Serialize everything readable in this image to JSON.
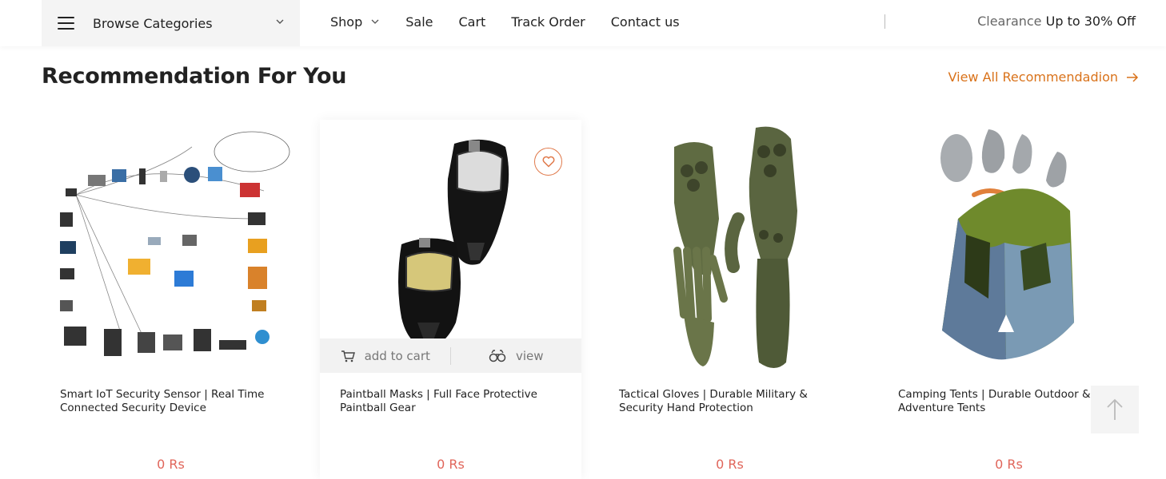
{
  "header": {
    "browse_label": "Browse Categories",
    "nav": [
      "Shop",
      "Sale",
      "Cart",
      "Track Order",
      "Contact us"
    ],
    "promo_muted": "Clearance",
    "promo_text": "Up to 30% Off"
  },
  "section": {
    "title": "Recommendation For You",
    "view_all": "View All Recommendadion"
  },
  "products": [
    {
      "title": "Smart IoT Security Sensor | Real Time Connected Security Device",
      "price": "0 Rs",
      "image": "iot-network-diagram"
    },
    {
      "title": "Paintball Masks | Full Face Protective Paintball Gear",
      "price": "0 Rs",
      "image": "paintball-masks"
    },
    {
      "title": "Tactical Gloves | Durable Military & Security Hand Protection",
      "price": "0 Rs",
      "image": "tactical-gloves"
    },
    {
      "title": "Camping Tents | Durable Outdoor & Adventure Tents",
      "price": "0 Rs",
      "image": "camping-tent"
    }
  ],
  "card_actions": {
    "add_to_cart": "add to cart",
    "view": "view"
  },
  "colors": {
    "accent": "#d9721a",
    "price": "#e0655a",
    "wish_border": "#e0794a"
  }
}
